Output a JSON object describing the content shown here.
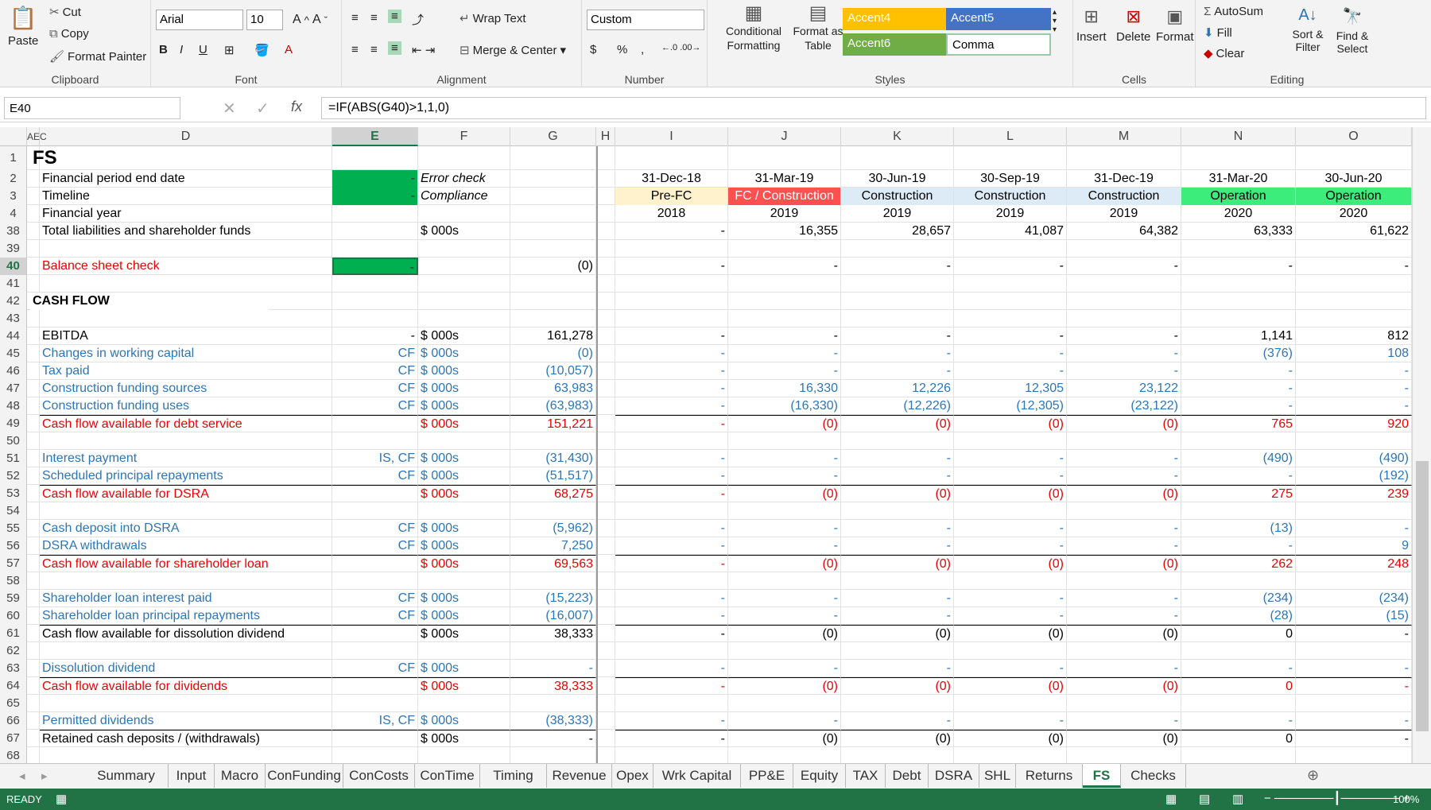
{
  "ribbon": {
    "clipboard": {
      "paste": "Paste",
      "cut": "Cut",
      "copy": "Copy",
      "format_painter": "Format Painter",
      "label": "Clipboard"
    },
    "font": {
      "name": "Arial",
      "size": "10",
      "label": "Font",
      "bold": "B",
      "italic": "I",
      "underline": "U"
    },
    "alignment": {
      "wrap": "Wrap Text",
      "merge": "Merge & Center",
      "label": "Alignment"
    },
    "number": {
      "format": "Custom",
      "currency": "$",
      "percent": "%",
      "comma": ",",
      "label": "Number"
    },
    "styles": {
      "conditional": "Conditional Formatting",
      "format_table": "Format as Table",
      "accent4": "Accent4",
      "accent5": "Accent5",
      "accent6": "Accent6",
      "comma": "Comma",
      "label": "Styles"
    },
    "cells": {
      "insert": "Insert",
      "delete": "Delete",
      "format": "Format",
      "label": "Cells"
    },
    "editing": {
      "autosum": "AutoSum",
      "fill": "Fill",
      "clear": "Clear",
      "sort": "Sort & Filter",
      "find": "Find & Select",
      "label": "Editing"
    }
  },
  "formula_bar": {
    "name_box": "E40",
    "formula": "=IF(ABS(G40)>1,1,0)",
    "fx": "fx"
  },
  "columns": [
    "AEC",
    "D",
    "E",
    "F",
    "G",
    "H",
    "I",
    "J",
    "K",
    "L",
    "M",
    "N",
    "O"
  ],
  "rows": [
    {
      "n": "1",
      "d": "FS",
      "style": "title"
    },
    {
      "n": "2",
      "d": "Financial period end date",
      "e": "-",
      "f": "Error check",
      "i": "31-Dec-18",
      "j": "31-Mar-19",
      "k": "30-Jun-19",
      "l": "30-Sep-19",
      "m": "31-Dec-19",
      "nn": "31-Mar-20",
      "o": "30-Jun-20",
      "style": "hdr"
    },
    {
      "n": "3",
      "d": "Timeline",
      "e": "-",
      "f": "Compliance",
      "i": "Pre-FC",
      "j": "FC / Construction",
      "k": "Construction",
      "l": "Construction",
      "m": "Construction",
      "nn": "Operation",
      "o": "Operation",
      "style": "timeline"
    },
    {
      "n": "4",
      "d": "Financial year",
      "i": "2018",
      "j": "2019",
      "k": "2019",
      "l": "2019",
      "m": "2019",
      "nn": "2020",
      "o": "2020",
      "style": "year"
    },
    {
      "n": "38",
      "d": "Total liabilities and shareholder funds",
      "f": "$ 000s",
      "i": "-",
      "j": "16,355",
      "k": "28,657",
      "l": "41,087",
      "m": "64,382",
      "nn": "63,333",
      "o": "61,622"
    },
    {
      "n": "39"
    },
    {
      "n": "40",
      "d": "Balance sheet check",
      "e": "-",
      "g": "(0)",
      "i": "-",
      "j": "-",
      "k": "-",
      "l": "-",
      "m": "-",
      "nn": "-",
      "o": "-",
      "style": "check"
    },
    {
      "n": "41"
    },
    {
      "n": "42",
      "c": "CASH FLOW",
      "style": "section"
    },
    {
      "n": "43"
    },
    {
      "n": "44",
      "d": "EBITDA",
      "e": "-",
      "f": "$ 000s",
      "g": "161,278",
      "i": "-",
      "j": "-",
      "k": "-",
      "l": "-",
      "m": "-",
      "nn": "1,141",
      "o": "812"
    },
    {
      "n": "45",
      "d": "Changes in working capital",
      "e": "CF",
      "f": "$ 000s",
      "g": "(0)",
      "i": "-",
      "j": "-",
      "k": "-",
      "l": "-",
      "m": "-",
      "nn": "(376)",
      "o": "108",
      "style": "blue"
    },
    {
      "n": "46",
      "d": "Tax paid",
      "e": "CF",
      "f": "$ 000s",
      "g": "(10,057)",
      "i": "-",
      "j": "-",
      "k": "-",
      "l": "-",
      "m": "-",
      "nn": "-",
      "o": "-",
      "style": "blue"
    },
    {
      "n": "47",
      "d": "Construction funding sources",
      "e": "CF",
      "f": "$ 000s",
      "g": "63,983",
      "i": "-",
      "j": "16,330",
      "k": "12,226",
      "l": "12,305",
      "m": "23,122",
      "nn": "-",
      "o": "-",
      "style": "blue"
    },
    {
      "n": "48",
      "d": "Construction funding uses",
      "e": "CF",
      "f": "$ 000s",
      "g": "(63,983)",
      "i": "-",
      "j": "(16,330)",
      "k": "(12,226)",
      "l": "(12,305)",
      "m": "(23,122)",
      "nn": "-",
      "o": "-",
      "style": "blue"
    },
    {
      "n": "49",
      "d": "Cash flow available for debt service",
      "f": "$ 000s",
      "g": "151,221",
      "i": "-",
      "j": "(0)",
      "k": "(0)",
      "l": "(0)",
      "m": "(0)",
      "nn": "765",
      "o": "920",
      "style": "red"
    },
    {
      "n": "50"
    },
    {
      "n": "51",
      "d": "Interest payment",
      "e": "IS, CF",
      "f": "$ 000s",
      "g": "(31,430)",
      "i": "-",
      "j": "-",
      "k": "-",
      "l": "-",
      "m": "-",
      "nn": "(490)",
      "o": "(490)",
      "style": "blue"
    },
    {
      "n": "52",
      "d": "Scheduled principal repayments",
      "e": "CF",
      "f": "$ 000s",
      "g": "(51,517)",
      "i": "-",
      "j": "-",
      "k": "-",
      "l": "-",
      "m": "-",
      "nn": "-",
      "o": "(192)",
      "style": "blue"
    },
    {
      "n": "53",
      "d": "Cash flow available for DSRA",
      "f": "$ 000s",
      "g": "68,275",
      "i": "-",
      "j": "(0)",
      "k": "(0)",
      "l": "(0)",
      "m": "(0)",
      "nn": "275",
      "o": "239",
      "style": "red"
    },
    {
      "n": "54"
    },
    {
      "n": "55",
      "d": "Cash deposit into DSRA",
      "e": "CF",
      "f": "$ 000s",
      "g": "(5,962)",
      "i": "-",
      "j": "-",
      "k": "-",
      "l": "-",
      "m": "-",
      "nn": "(13)",
      "o": "-",
      "style": "blue"
    },
    {
      "n": "56",
      "d": "DSRA withdrawals",
      "e": "CF",
      "f": "$ 000s",
      "g": "7,250",
      "i": "-",
      "j": "-",
      "k": "-",
      "l": "-",
      "m": "-",
      "nn": "-",
      "o": "9",
      "style": "blue"
    },
    {
      "n": "57",
      "d": "Cash flow available for shareholder loan",
      "f": "$ 000s",
      "g": "69,563",
      "i": "-",
      "j": "(0)",
      "k": "(0)",
      "l": "(0)",
      "m": "(0)",
      "nn": "262",
      "o": "248",
      "style": "red"
    },
    {
      "n": "58"
    },
    {
      "n": "59",
      "d": "Shareholder loan interest paid",
      "e": "CF",
      "f": "$ 000s",
      "g": "(15,223)",
      "i": "-",
      "j": "-",
      "k": "-",
      "l": "-",
      "m": "-",
      "nn": "(234)",
      "o": "(234)",
      "style": "blue"
    },
    {
      "n": "60",
      "d": "Shareholder loan principal repayments",
      "e": "CF",
      "f": "$ 000s",
      "g": "(16,007)",
      "i": "-",
      "j": "-",
      "k": "-",
      "l": "-",
      "m": "-",
      "nn": "(28)",
      "o": "(15)",
      "style": "blue"
    },
    {
      "n": "61",
      "d": "Cash flow available for dissolution dividend",
      "f": "$ 000s",
      "g": "38,333",
      "i": "-",
      "j": "(0)",
      "k": "(0)",
      "l": "(0)",
      "m": "(0)",
      "nn": "0",
      "o": "-",
      "style": "black"
    },
    {
      "n": "62"
    },
    {
      "n": "63",
      "d": "Dissolution dividend",
      "e": "CF",
      "f": "$ 000s",
      "g": "-",
      "i": "-",
      "j": "-",
      "k": "-",
      "l": "-",
      "m": "-",
      "nn": "-",
      "o": "-",
      "style": "blue"
    },
    {
      "n": "64",
      "d": "Cash flow available for dividends",
      "f": "$ 000s",
      "g": "38,333",
      "i": "-",
      "j": "(0)",
      "k": "(0)",
      "l": "(0)",
      "m": "(0)",
      "nn": "0",
      "o": "-",
      "style": "red"
    },
    {
      "n": "65"
    },
    {
      "n": "66",
      "d": "Permitted dividends",
      "e": "IS, CF",
      "f": "$ 000s",
      "g": "(38,333)",
      "i": "-",
      "j": "-",
      "k": "-",
      "l": "-",
      "m": "-",
      "nn": "-",
      "o": "-",
      "style": "blue"
    },
    {
      "n": "67",
      "d": "Retained cash deposits / (withdrawals)",
      "f": "$ 000s",
      "g": "-",
      "i": "-",
      "j": "(0)",
      "k": "(0)",
      "l": "(0)",
      "m": "(0)",
      "nn": "0",
      "o": "-",
      "style": "black"
    },
    {
      "n": "68"
    }
  ],
  "tabs": [
    "Summary",
    "Input",
    "Macro",
    "ConFunding",
    "ConCosts",
    "ConTime",
    "Timing",
    "Revenue",
    "Opex",
    "Wrk Capital",
    "PP&E",
    "Equity",
    "TAX",
    "Debt",
    "DSRA",
    "SHL",
    "Returns",
    "FS",
    "Checks"
  ],
  "active_tab": "FS",
  "status": {
    "mode": "READY",
    "zoom": "100%"
  },
  "colors": {
    "excel_green": "#217346",
    "check_green": "#00b050",
    "prefc": "#fff2cc",
    "fc": "#ff5050",
    "construction": "#ddebf7",
    "operation": "#3ded7b",
    "accent4": "#ffc000",
    "accent5": "#4472c4",
    "accent6": "#70ad47"
  }
}
